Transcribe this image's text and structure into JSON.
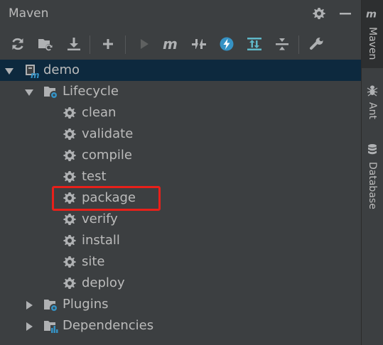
{
  "panel": {
    "title": "Maven",
    "header_buttons": [
      "gear-icon",
      "minimize-icon"
    ]
  },
  "toolbar": {
    "buttons": [
      {
        "name": "reload-all-projects",
        "icon": "refresh-icon"
      },
      {
        "name": "generate-sources",
        "icon": "folder-refresh-icon"
      },
      {
        "name": "download-sources",
        "icon": "download-icon"
      },
      {
        "name": "add-maven-project",
        "icon": "plus-icon"
      },
      {
        "name": "run-maven-build",
        "icon": "run-icon"
      },
      {
        "name": "execute-maven-goal",
        "icon": "maven-m-icon"
      },
      {
        "name": "toggle-offline-mode",
        "icon": "offline-icon"
      },
      {
        "name": "skip-tests",
        "icon": "lightning-icon"
      },
      {
        "name": "show-dependencies",
        "icon": "dependencies-icon"
      },
      {
        "name": "collapse-all",
        "icon": "collapse-icon"
      },
      {
        "name": "maven-settings",
        "icon": "wrench-icon"
      }
    ]
  },
  "tree": {
    "root": {
      "label": "demo",
      "expanded": true
    },
    "lifecycle": {
      "label": "Lifecycle",
      "expanded": true
    },
    "goals": [
      "clean",
      "validate",
      "compile",
      "test",
      "package",
      "verify",
      "install",
      "site",
      "deploy"
    ],
    "plugins": {
      "label": "Plugins",
      "expanded": false
    },
    "dependencies": {
      "label": "Dependencies",
      "expanded": false
    }
  },
  "right_tabs": [
    {
      "label": "Maven",
      "icon": "maven-m-icon",
      "active": true
    },
    {
      "label": "Ant",
      "icon": "ant-icon",
      "active": false
    },
    {
      "label": "Database",
      "icon": "database-icon",
      "active": false
    }
  ],
  "colors": {
    "background": "#3c3f41",
    "selection": "#0d293e",
    "text": "#bbbbbb",
    "icon": "#afb1b3",
    "highlight_box": "#e8201a",
    "skip_tests_button": "#3592c4"
  }
}
